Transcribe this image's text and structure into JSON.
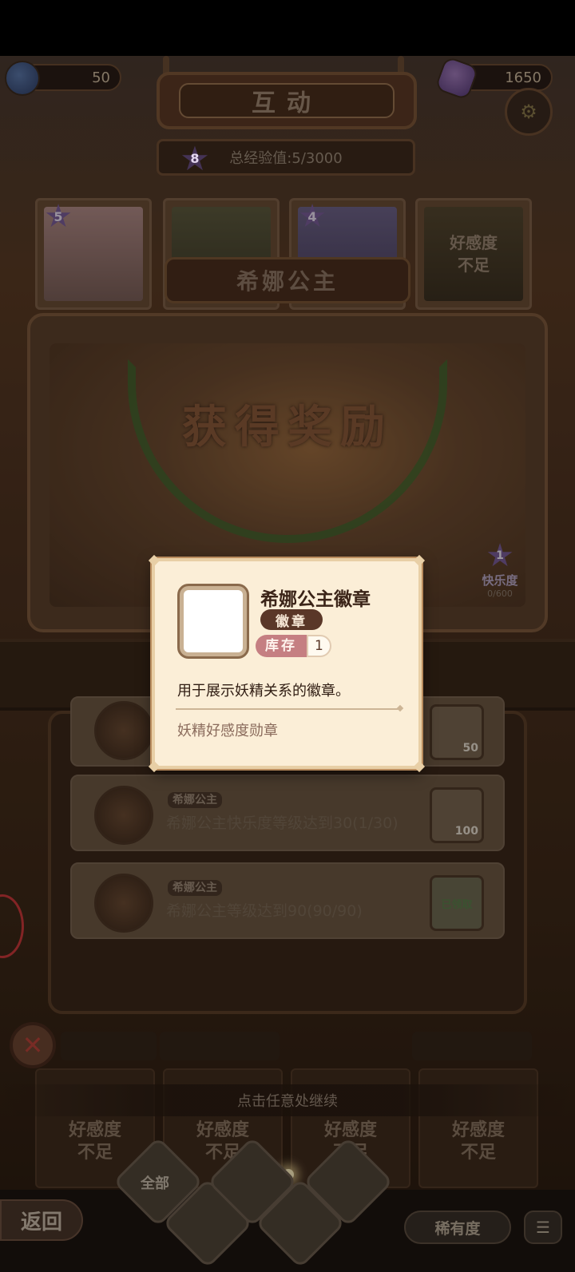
{
  "header": {
    "title": "互动",
    "left_currency_value": "50",
    "right_currency_value": "1650",
    "xp_level": "8",
    "xp_text": "总经验值:5/3000"
  },
  "fairy_cards": [
    {
      "level": "5",
      "low_favor": ""
    },
    {
      "level": "",
      "low_favor": ""
    },
    {
      "level": "4",
      "low_favor": ""
    },
    {
      "level": "",
      "low_favor_line1": "好感度",
      "low_favor_line2": "不足"
    }
  ],
  "selected_fairy_name": "希娜公主",
  "reward_banner": {
    "title": "获得奖励",
    "happiness_level": "1",
    "happiness_label": "快乐度",
    "happiness_value": "0/600"
  },
  "tasks": [
    {
      "tag": "",
      "desc": "",
      "reward_count": "50",
      "claimed": false
    },
    {
      "tag": "希娜公主",
      "desc": "希娜公主快乐度等级达到30(1/30)",
      "reward_count": "100",
      "claimed": false
    },
    {
      "tag": "希娜公主",
      "desc": "希娜公主等级达到90(90/90)",
      "reward_count": "1",
      "claimed": true,
      "claimed_label": "已领取"
    }
  ],
  "bottom_cards": [
    {
      "line1": "好感度",
      "line2": "不足"
    },
    {
      "line1": "好感度",
      "line2": "不足"
    },
    {
      "line1": "好感度",
      "line2": "不足"
    },
    {
      "line1": "好感度",
      "line2": "不足"
    }
  ],
  "continue_hint": "点击任意处继续",
  "nav": {
    "back_label": "返回",
    "filter_all_label": "全部",
    "sort_label": "稀有度"
  },
  "popup": {
    "item_name": "希娜公主徽章",
    "item_type": "徽章",
    "stock_label": "库存",
    "stock_count": "1",
    "description": "用于展示妖精关系的徽章。",
    "subtext": "妖精好感度勋章"
  },
  "icons": {
    "left_currency": "star-coin-icon",
    "right_currency": "gem-icon",
    "settings": "settings-icon",
    "close": "close-icon",
    "list": "list-sort-icon"
  }
}
